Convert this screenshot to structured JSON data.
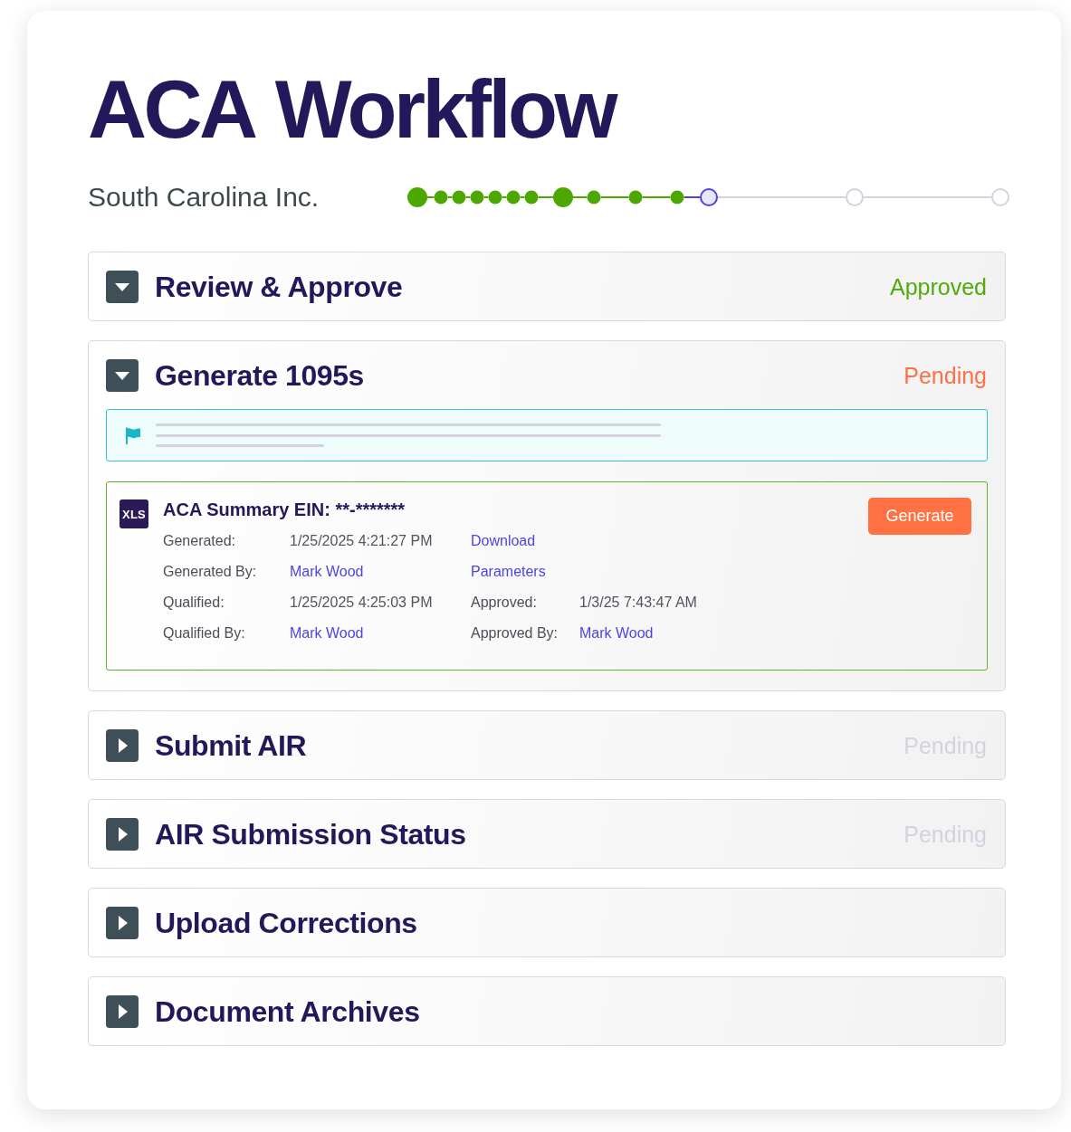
{
  "title": "ACA Workflow",
  "company": "South Carolina Inc.",
  "progress": {
    "steps": [
      {
        "completed": true,
        "current": false,
        "children": [
          {
            "completed": true
          },
          {
            "completed": true
          },
          {
            "completed": true
          },
          {
            "completed": true
          },
          {
            "completed": true
          },
          {
            "completed": true
          }
        ]
      },
      {
        "completed": true,
        "current": false,
        "children": [
          {
            "completed": true
          },
          {
            "completed": true
          },
          {
            "completed": true
          }
        ]
      },
      {
        "completed": false,
        "current": true
      },
      {
        "completed": false,
        "current": false
      },
      {
        "completed": false,
        "current": false
      }
    ]
  },
  "sections": [
    {
      "title": "Review & Approve",
      "expanded": true,
      "status": {
        "text": "Approved",
        "kind": "approved"
      }
    },
    {
      "title": "Generate 1095s",
      "expanded": true,
      "status": {
        "text": "Pending",
        "kind": "in_progress"
      },
      "notice": {
        "kind": "placeholder"
      },
      "document": {
        "file_type": "XLS",
        "title": "ACA Summary EIN: **-*******",
        "action": "Generate",
        "rows": [
          {
            "cells": [
              {
                "kind": "label",
                "text": "Generated:"
              },
              {
                "kind": "value",
                "text": "1/25/2025 4:21:27 PM"
              },
              {
                "kind": "link",
                "text": "Download"
              }
            ]
          },
          {
            "cells": [
              {
                "kind": "label",
                "text": "Generated By:"
              },
              {
                "kind": "link",
                "text": "Mark Wood"
              },
              {
                "kind": "link",
                "text": "Parameters"
              }
            ]
          },
          {
            "cells": [
              {
                "kind": "label",
                "text": "Qualified:"
              },
              {
                "kind": "value",
                "text": "1/25/2025 4:25:03 PM"
              },
              {
                "kind": "label",
                "text": "Approved:"
              },
              {
                "kind": "value",
                "text": "1/3/25 7:43:47 AM"
              }
            ]
          },
          {
            "cells": [
              {
                "kind": "label",
                "text": "Qualified By:"
              },
              {
                "kind": "link",
                "text": "Mark Wood"
              },
              {
                "kind": "label",
                "text": "Approved By:"
              },
              {
                "kind": "link",
                "text": "Mark Wood"
              }
            ]
          }
        ]
      }
    },
    {
      "title": "Submit AIR",
      "expanded": false,
      "status": {
        "text": "Pending",
        "kind": "upcoming"
      }
    },
    {
      "title": "AIR Submission Status",
      "expanded": false,
      "status": {
        "text": "Pending",
        "kind": "upcoming"
      }
    },
    {
      "title": "Upload Corrections",
      "expanded": false
    },
    {
      "title": "Document Archives",
      "expanded": false
    }
  ]
}
